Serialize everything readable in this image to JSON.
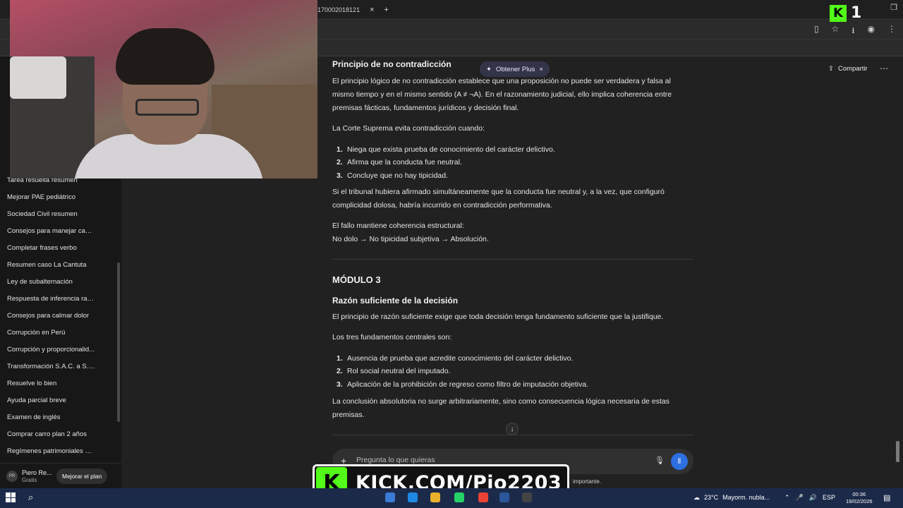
{
  "browser": {
    "tab_title": "2170002018121",
    "tab_close": "×",
    "new_tab": "+"
  },
  "sidebar": {
    "items": [
      "Tarea resuelta resumen",
      "Mejorar PAE pediátrico",
      "Sociedad Civil resumen",
      "Consejos para manejar cans...",
      "Completar frases verbo",
      "Resumen caso La Cantuta",
      "Ley de subalternación",
      "Respuesta de inferencia raci...",
      "Consejos para calmar dolor",
      "Corrupción en Perú",
      "Corrupción y proporcionalid...",
      "Transformación S.A.C. a S.A.A.",
      "Resuelve lo bien",
      "Ayuda parcial breve",
      "Examen de inglés",
      "Comprar carro plan 2 años",
      "Regímenes patrimoniales Perú"
    ],
    "user": {
      "initials": "PR",
      "name": "Piero Re...",
      "plan": "Gratis",
      "upgrade_label": "Mejorar el plan"
    }
  },
  "header": {
    "plus_pill": "Obtener Plus",
    "plus_close": "×",
    "share_label": "Compartir",
    "more": "⋯"
  },
  "content": {
    "section1_title": "Principio de no contradicción",
    "section1_p1": "El principio lógico de no contradicción establece que una proposición no puede ser verdadera y falsa al mismo tiempo y en el mismo sentido (A ≠ ¬A). En el razonamiento judicial, ello implica coherencia entre premisas fácticas, fundamentos jurídicos y decisión final.",
    "section1_p2": "La Corte Suprema evita contradicción cuando:",
    "section1_list": [
      "Niega que exista prueba de conocimiento del carácter delictivo.",
      "Afirma que la conducta fue neutral.",
      "Concluye que no hay tipicidad."
    ],
    "section1_p3": "Si el tribunal hubiera afirmado simultáneamente que la conducta fue neutral y, a la vez, que configuró complicidad dolosa, habría incurrido en contradicción performativa.",
    "section1_p4": "El fallo mantiene coherencia estructural:",
    "section1_p5": "No dolo → No tipicidad subjetiva → Absolución.",
    "module_title": "MÓDULO 3",
    "section2_title": "Razón suficiente de la decisión",
    "section2_p1": "El principio de razón suficiente exige que toda decisión tenga fundamento suficiente que la justifique.",
    "section2_p2": "Los tres fundamentos centrales son:",
    "section2_list": [
      "Ausencia de prueba que acredite conocimiento del carácter delictivo.",
      "Rol social neutral del imputado.",
      "Aplicación de la prohibición de regreso como filtro de imputación objetiva."
    ],
    "section2_p3": "La conclusión absolutoria no surge arbitrariamente, sino como consecuencia lógica necesaria de estas premisas."
  },
  "composer": {
    "placeholder": "Pregunta lo que quieras"
  },
  "disclaimer": "importante.",
  "overlay": {
    "kick_text": "KICK.COM/Pio2203",
    "kick_logo": "K",
    "corner_number": "1"
  },
  "taskbar": {
    "weather_temp": "23°C",
    "weather_desc": "Mayorm. nubla...",
    "lang": "ESP",
    "time": "00:36",
    "date": "19/02/2026"
  },
  "colors": {
    "kick_green": "#53fc18",
    "voice_blue": "#2d6fe0",
    "sidebar_bg": "#171717",
    "main_bg": "#212121"
  }
}
